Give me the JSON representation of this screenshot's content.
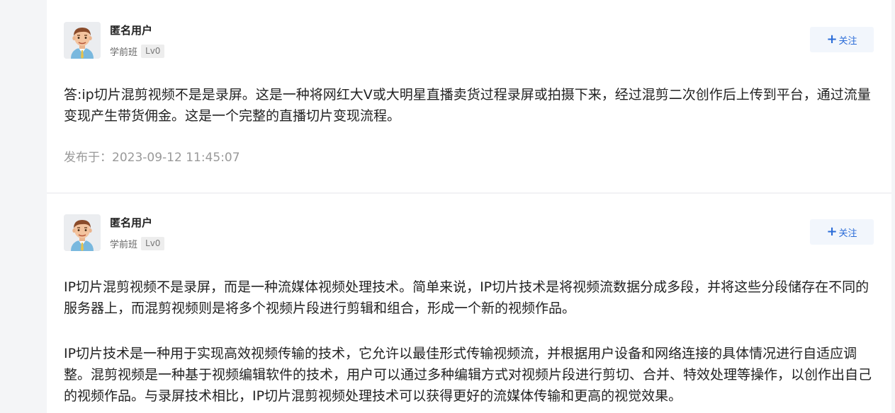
{
  "answers": [
    {
      "user": {
        "name": "匿名用户",
        "title": "学前班",
        "level": "Lv0"
      },
      "follow_label": "关注",
      "follow_icon": "plus-icon",
      "paragraphs": [
        "答:ip切片混剪视频不是是录屏。这是一种将网红大V或大明星直播卖货过程录屏或拍摄下来，经过混剪二次创作后上传到平台，通过流量变现产生带货佣金。这是一个完整的直播切片变现流程。"
      ],
      "published": "发布于：2023-09-12 11:45:07"
    },
    {
      "user": {
        "name": "匿名用户",
        "title": "学前班",
        "level": "Lv0"
      },
      "follow_label": "关注",
      "follow_icon": "plus-icon",
      "paragraphs": [
        "IP切片混剪视频不是录屏，而是一种流媒体视频处理技术。简单来说，IP切片技术是将视频流数据分成多段，并将这些分段储存在不同的服务器上，而混剪视频则是将多个视频片段进行剪辑和组合，形成一个新的视频作品。",
        "IP切片技术是一种用于实现高效视频传输的技术，它允许以最佳形式传输视频流，并根据用户设备和网络连接的具体情况进行自适应调整。混剪视频是一种基于视频编辑软件的技术，用户可以通过多种编辑方式对视频片段进行剪切、合并、特效处理等操作，以创作出自己的视频作品。与录屏技术相比，IP切片混剪视频处理技术可以获得更好的流媒体传输和更高的视觉效果。"
      ]
    }
  ],
  "colors": {
    "accent": "#2b6cd8",
    "follow_bg": "#f2f6fc",
    "text": "#222222",
    "muted": "#999999",
    "page_bg": "#f4f5f7"
  }
}
